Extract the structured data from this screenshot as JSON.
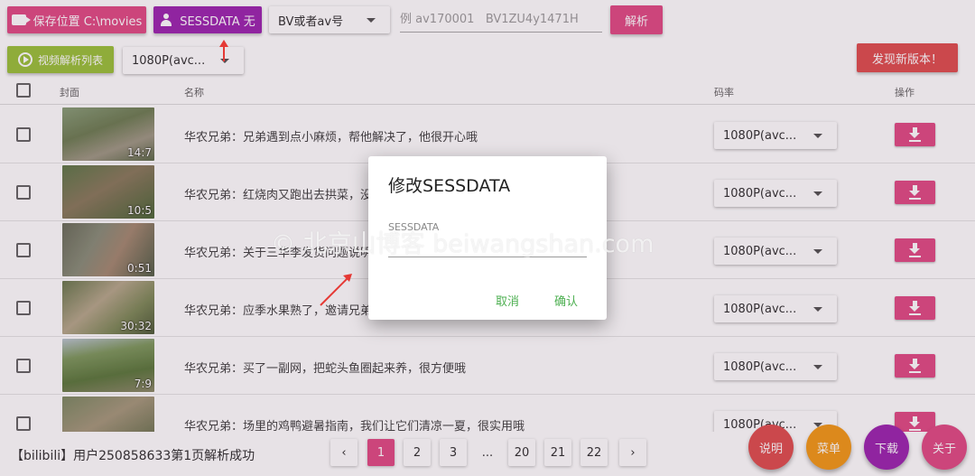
{
  "toolbar": {
    "save_location": "保存位置 C:\\movies",
    "sessdata": "SESSDATA 无",
    "id_type": "BV或者av号",
    "search_placeholder": "例 av170001   BV1ZU4y1471H",
    "parse": "解析",
    "video_list": "视频解析列表",
    "quality": "1080P(avc...",
    "new_version": "发现新版本！"
  },
  "table": {
    "headers": {
      "cover": "封面",
      "name": "名称",
      "bitrate": "码率",
      "action": "操作"
    },
    "rows": [
      {
        "title": "华农兄弟：兄弟遇到点小麻烦，帮他解决了，他很开心哦",
        "duration": "14:7",
        "quality": "1080P(avc..."
      },
      {
        "title": "华农兄弟：红烧肉又跑出去拱菜，没",
        "duration": "10:5",
        "quality": "1080P(avc..."
      },
      {
        "title": "华农兄弟：关于三华李发货问题说明",
        "duration": "0:51",
        "quality": "1080P(avc..."
      },
      {
        "title": "华农兄弟：应季水果熟了，邀请兄弟",
        "duration": "30:32",
        "quality": "1080P(avc..."
      },
      {
        "title": "华农兄弟：买了一副网，把蛇头鱼圈起来养，很方便哦",
        "duration": "7:9",
        "quality": "1080P(avc..."
      },
      {
        "title": "华农兄弟：场里的鸡鸭避暑指南，我们让它们清凉一夏，很实用哦",
        "duration": "",
        "quality": "1080P(avc..."
      }
    ]
  },
  "footer": {
    "status": "【bilibili】用户250858633第1页解析成功",
    "pages": [
      "1",
      "2",
      "3",
      "...",
      "20",
      "21",
      "22"
    ],
    "current_page": "1"
  },
  "fabs": {
    "help": "说明",
    "menu": "菜单",
    "download": "下载",
    "about": "关于"
  },
  "dialog": {
    "title": "修改SESSDATA",
    "label": "SESSDATA",
    "input_value": "",
    "cancel": "取消",
    "confirm": "确认"
  },
  "watermark": "© 北京山博客 beiwangshan.com",
  "colors": {
    "primary": "#e14d86",
    "purple": "#9c27b0",
    "green": "#9bc23c",
    "red": "#e05050",
    "orange": "#f39a1a",
    "dialog_button": "#4caf50"
  }
}
